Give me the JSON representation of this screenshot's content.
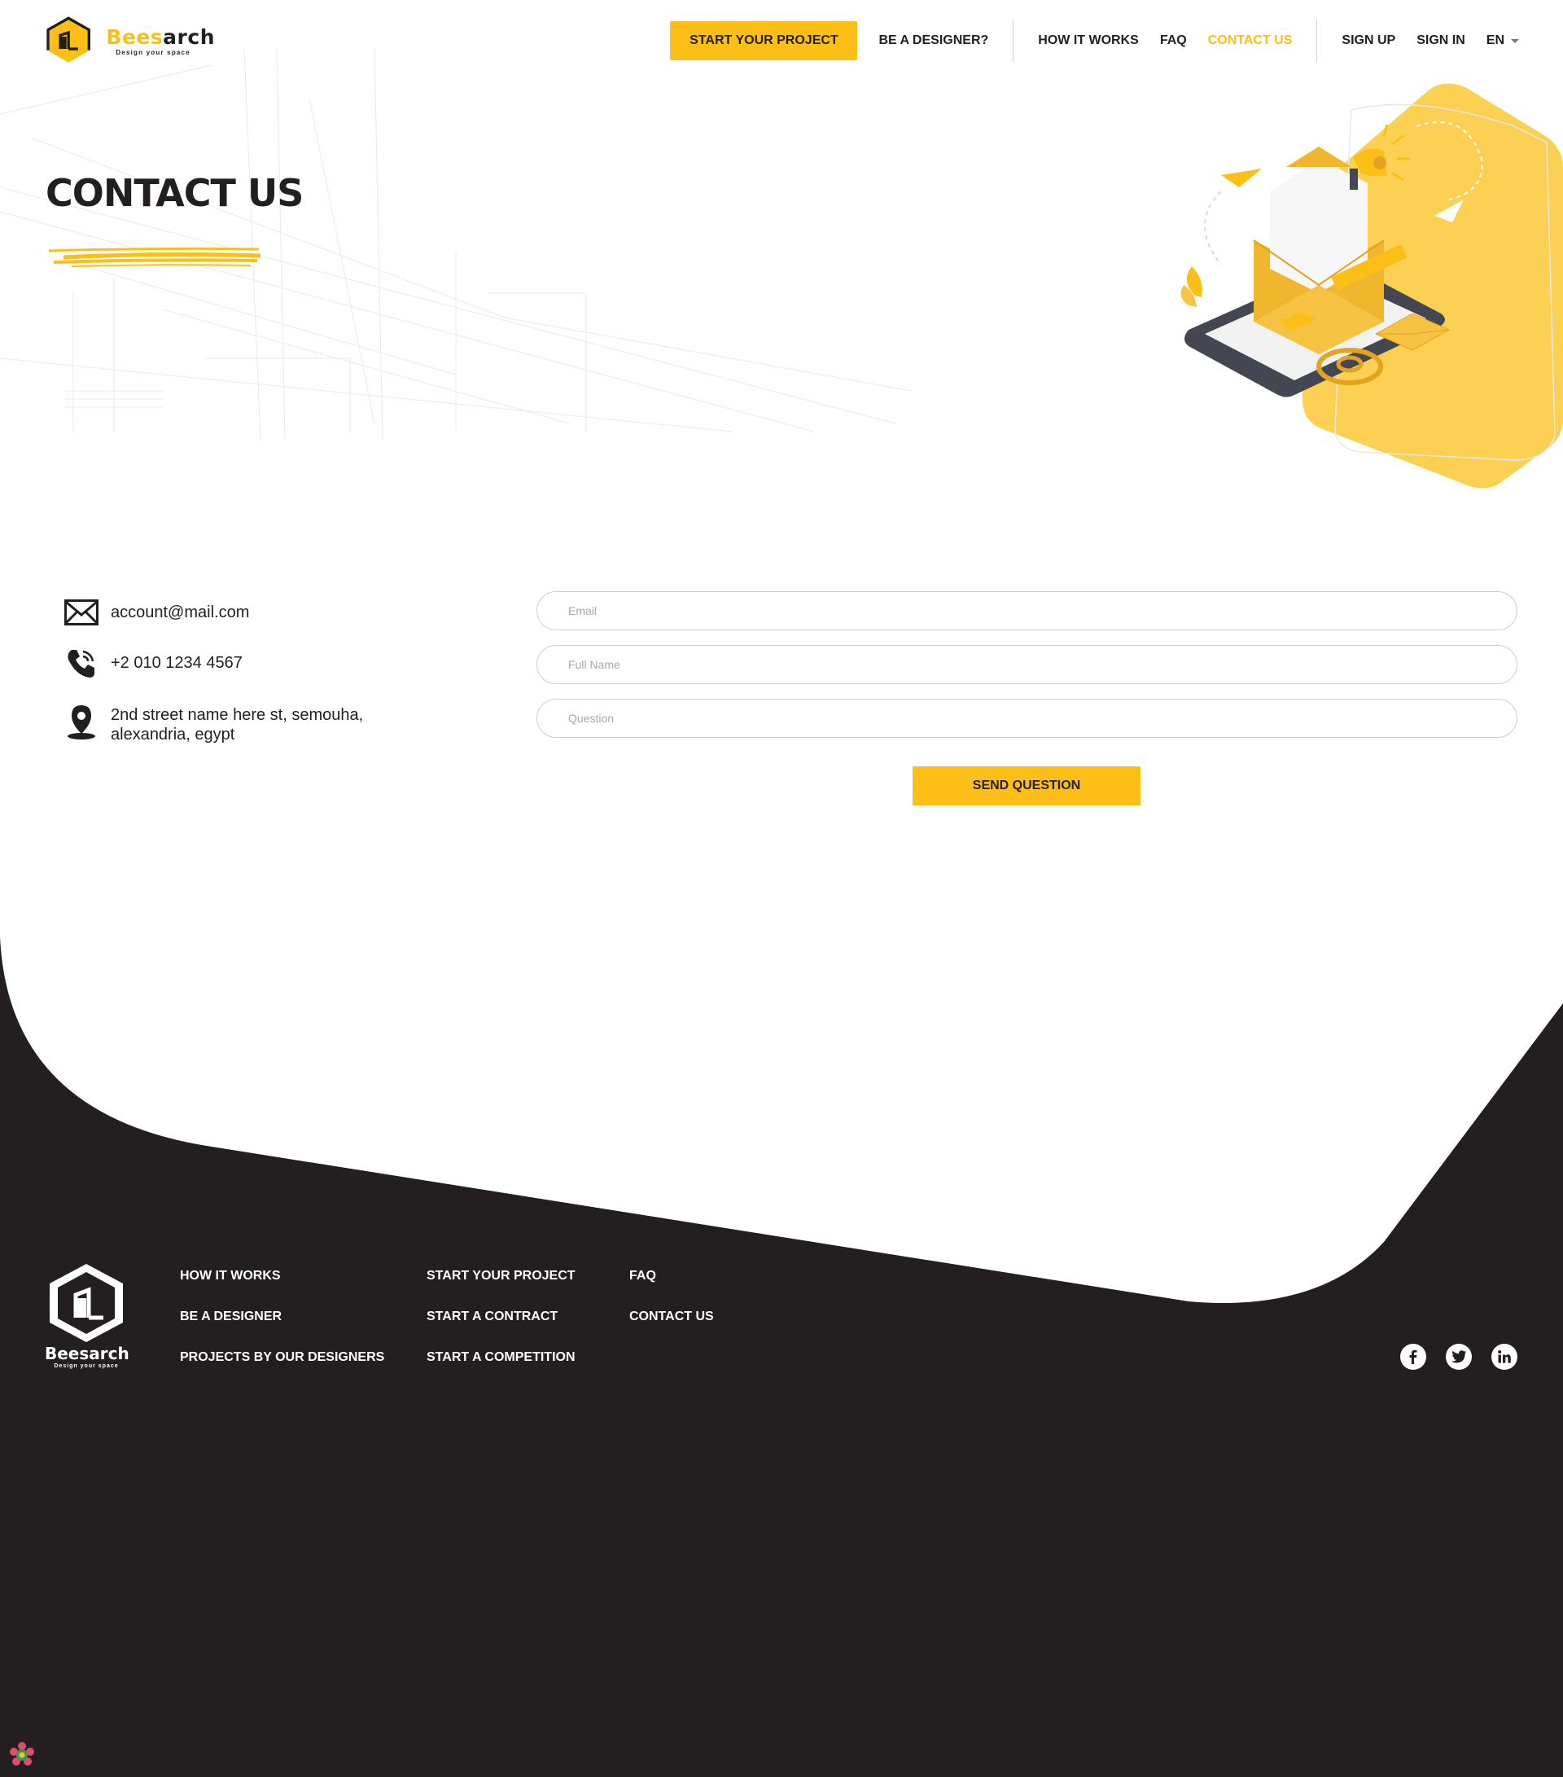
{
  "brand": {
    "name_part1": "Bees",
    "name_part2": "arch",
    "tagline": "Design your space",
    "footer_name": "Beesarch",
    "accent_color": "#fcbf17",
    "dark_color": "#231f20"
  },
  "nav": {
    "start_project": "START YOUR PROJECT",
    "be_designer": "BE A DESIGNER?",
    "how_it_works": "HOW IT WORKS",
    "faq": "FAQ",
    "contact_us": "CONTACT US",
    "sign_up": "SIGN UP",
    "sign_in": "SIGN IN",
    "language": "EN"
  },
  "hero": {
    "title": "CONTACT US"
  },
  "contact_info": {
    "email": "account@mail.com",
    "phone": "+2 010 1234 4567",
    "address_line1": "2nd street name here st, semouha,",
    "address_line2": "alexandria, egypt"
  },
  "form": {
    "email_placeholder": "Email",
    "name_placeholder": "Full Name",
    "question_placeholder": "Question",
    "submit_label": "SEND QUESTION"
  },
  "footer": {
    "col1": [
      "HOW IT WORKS",
      "BE A DESIGNER",
      "PROJECTS BY OUR DESIGNERS"
    ],
    "col2": [
      "START YOUR PROJECT",
      "START A CONTRACT",
      "START A COMPETITION"
    ],
    "col3": [
      "FAQ",
      "CONTACT US"
    ],
    "social": [
      "facebook-icon",
      "twitter-icon",
      "linkedin-icon"
    ]
  }
}
